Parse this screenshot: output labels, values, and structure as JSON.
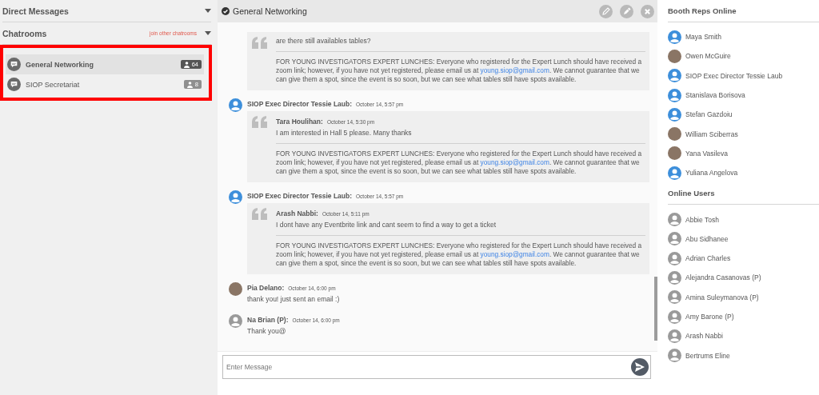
{
  "sidebar": {
    "direct_messages": {
      "title": "Direct Messages"
    },
    "chatrooms": {
      "title": "Chatrooms",
      "join_link": "join other chatrooms",
      "highlighted": true,
      "rooms": [
        {
          "name": "General Networking",
          "count": "64",
          "selected": true
        },
        {
          "name": "SIOP Secretariat",
          "count": "8",
          "selected": false
        }
      ]
    }
  },
  "chat": {
    "title": "General Networking",
    "messages": [
      {
        "quote": {
          "text": "are there still availables tables?",
          "notice": {
            "before": "FOR YOUNG INVESTIGATORS EXPERT LUNCHES: Everyone who registered for the Expert Lunch should have received a zoom link; however, if you have not yet registered, please email us at ",
            "link": "young.siop@gmail.com",
            "after": ". We cannot guarantee that we can give them a spot, since the event is so soon, but we can see what tables still have spots available."
          }
        }
      },
      {
        "avatar": {
          "kind": "default-blue"
        },
        "author": "SIOP Exec Director Tessie Laub:",
        "time": "October 14, 5:57 pm",
        "quote": {
          "author": "Tara Houlihan:",
          "time": "October 14, 5:30 pm",
          "text": "I am interested in Hall 5 please. Many thanks",
          "notice": {
            "before": "FOR YOUNG INVESTIGATORS EXPERT LUNCHES: Everyone who registered for the Expert Lunch should have received a zoom link; however, if you have not yet registered, please email us at ",
            "link": "young.siop@gmail.com",
            "after": ". We cannot guarantee that we can give them a spot, since the event is so soon, but we can see what tables still have spots available."
          }
        }
      },
      {
        "avatar": {
          "kind": "default-blue"
        },
        "author": "SIOP Exec Director Tessie Laub:",
        "time": "October 14, 5:57 pm",
        "quote": {
          "author": "Arash Nabbi:",
          "time": "October 14, 5:11 pm",
          "text": "I dont have any Eventbrite link and cant seem to find a way to get a ticket",
          "notice": {
            "before": "FOR YOUNG INVESTIGATORS EXPERT LUNCHES: Everyone who registered for the Expert Lunch should have received a zoom link; however, if you have not yet registered, please email us at ",
            "link": "young.siop@gmail.com",
            "after": ". We cannot guarantee that we can give them a spot, since the event is so soon, but we can see what tables still have spots available."
          }
        }
      },
      {
        "avatar": {
          "kind": "photo"
        },
        "author": "Pia Delano:",
        "time": "October 14, 6:00 pm",
        "text": "thank you! just sent an email :)"
      },
      {
        "avatar": {
          "kind": "default-grey"
        },
        "author": "Na Brian (P):",
        "time": "October 14, 6:00 pm",
        "text": "Thank you@"
      }
    ],
    "input": {
      "placeholder": "Enter Message"
    }
  },
  "booth_reps": {
    "title": "Booth Reps Online",
    "users": [
      {
        "name": "Maya Smith",
        "avatar": {
          "kind": "default-blue"
        }
      },
      {
        "name": "Owen McGuire",
        "avatar": {
          "kind": "photo"
        }
      },
      {
        "name": "SIOP Exec Director Tessie Laub",
        "avatar": {
          "kind": "default-blue"
        }
      },
      {
        "name": "Stanislava Borisova",
        "avatar": {
          "kind": "default-blue"
        }
      },
      {
        "name": "Stefan Gazdoiu",
        "avatar": {
          "kind": "default-blue"
        }
      },
      {
        "name": "William Sciberras",
        "avatar": {
          "kind": "photo"
        }
      },
      {
        "name": "Yana Vasileva",
        "avatar": {
          "kind": "photo"
        }
      },
      {
        "name": "Yuliana Angelova",
        "avatar": {
          "kind": "default-blue"
        }
      }
    ]
  },
  "online_users": {
    "title": "Online Users",
    "users": [
      {
        "name": "Abbie Tosh",
        "avatar": {
          "kind": "default-grey"
        }
      },
      {
        "name": "Abu Sidhanee",
        "avatar": {
          "kind": "default-grey"
        }
      },
      {
        "name": "Adrian Charles",
        "avatar": {
          "kind": "default-grey"
        }
      },
      {
        "name": "Alejandra Casanovas (P)",
        "avatar": {
          "kind": "default-grey"
        }
      },
      {
        "name": "Amina Suleymanova (P)",
        "avatar": {
          "kind": "default-grey"
        }
      },
      {
        "name": "Amy Barone (P)",
        "avatar": {
          "kind": "default-grey"
        }
      },
      {
        "name": "Arash Nabbi",
        "avatar": {
          "kind": "default-grey"
        }
      },
      {
        "name": "Bertrums Eline",
        "avatar": {
          "kind": "default-grey"
        }
      }
    ]
  }
}
